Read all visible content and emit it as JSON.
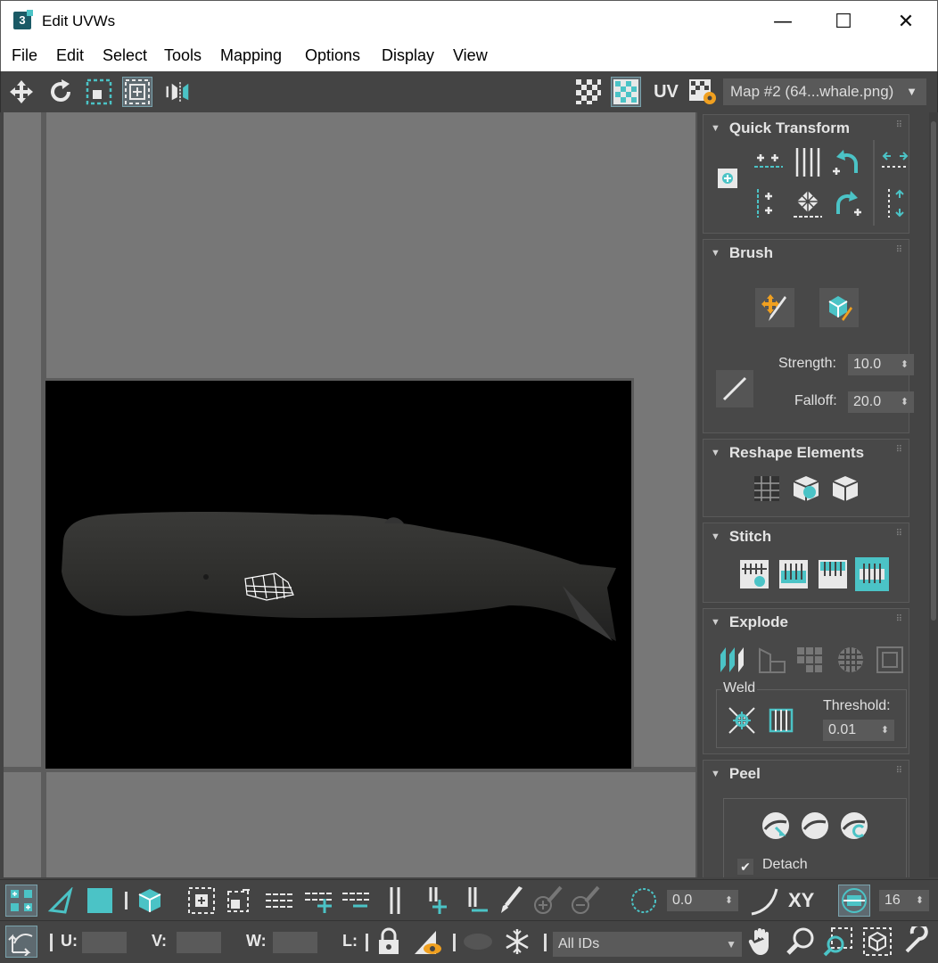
{
  "window": {
    "title": "Edit UVWs",
    "app_icon_text": "3",
    "minimize": "—",
    "maximize": "☐",
    "close": "✕"
  },
  "menu": [
    "File",
    "Edit",
    "Select",
    "Tools",
    "Mapping",
    "Options",
    "Display",
    "View"
  ],
  "toolbar": {
    "uv_label": "UV",
    "map_select": "Map #2 (64...whale.png)"
  },
  "quick_transform": {
    "title": "Quick Transform"
  },
  "brush": {
    "title": "Brush",
    "strength_label": "Strength:",
    "strength_value": "10.0",
    "falloff_label": "Falloff:",
    "falloff_value": "20.0"
  },
  "reshape": {
    "title": "Reshape Elements"
  },
  "stitch": {
    "title": "Stitch"
  },
  "explode": {
    "title": "Explode",
    "weld_label": "Weld",
    "threshold_label": "Threshold:",
    "threshold_value": "0.01"
  },
  "peel": {
    "title": "Peel",
    "detach_label": "Detach"
  },
  "bottom": {
    "angle_value": "0.0",
    "xy_label": "XY",
    "snap_value": "16",
    "u_label": "U:",
    "v_label": "V:",
    "w_label": "W:",
    "l_label": "L:",
    "ids_select": "All IDs"
  },
  "colors": {
    "accent": "#4bc3c6",
    "panel": "#444444",
    "viewport": "#777777"
  }
}
